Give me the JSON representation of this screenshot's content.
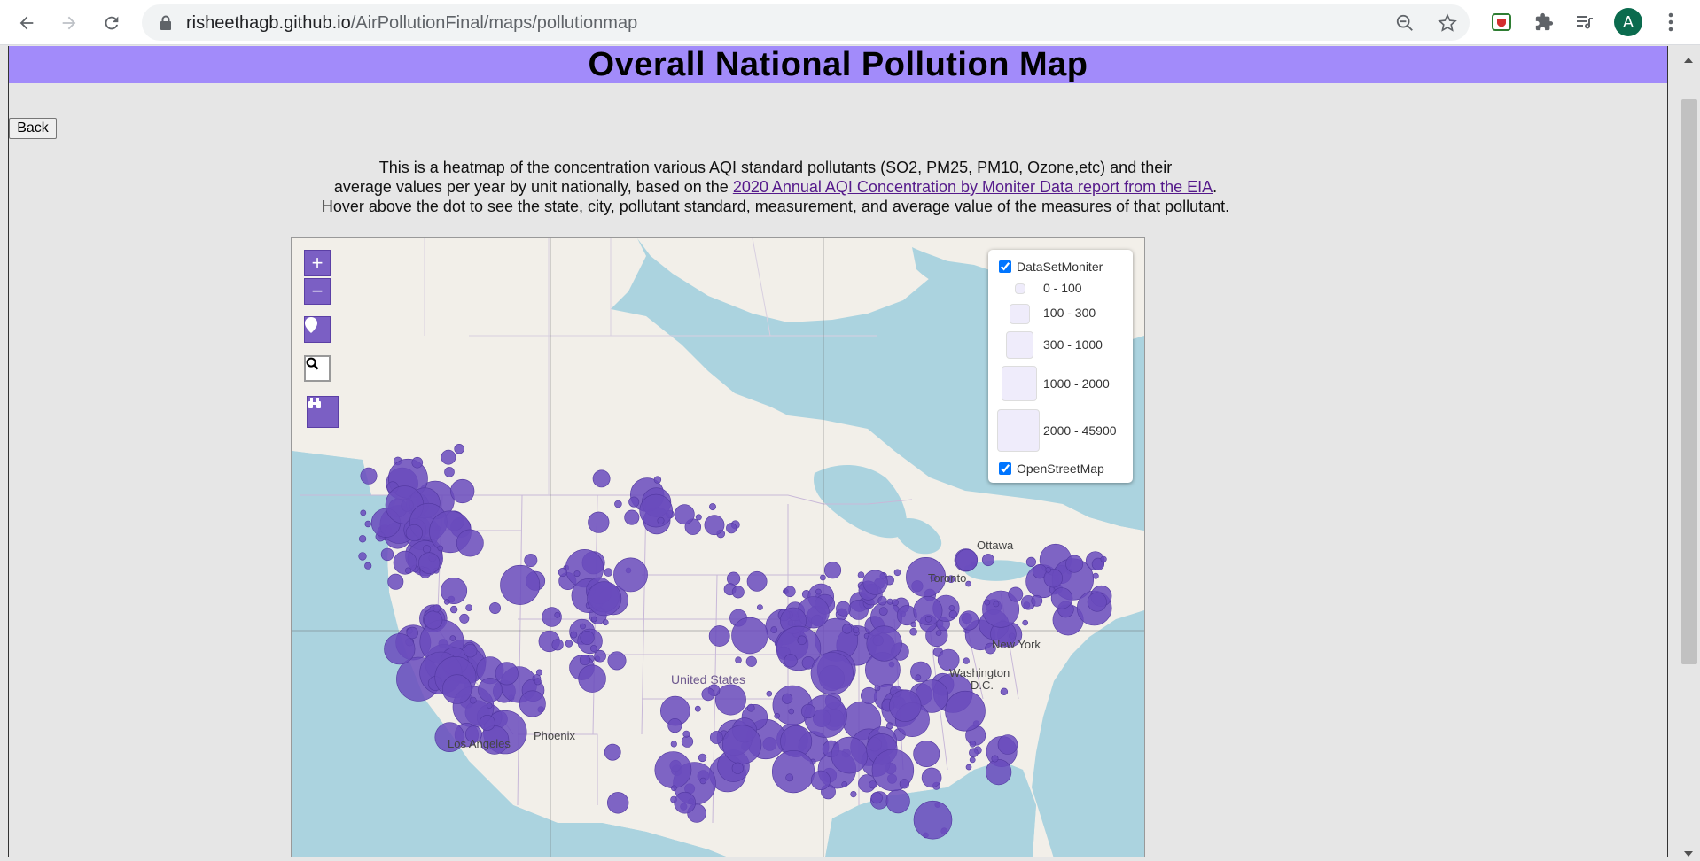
{
  "browser": {
    "url_host": "risheethagb.github.io",
    "url_path": "/AirPollutionFinal/maps/pollutionmap",
    "avatar_letter": "A"
  },
  "page": {
    "title": "Overall National Pollution Map",
    "back_label": "Back",
    "desc_line1": "This is a heatmap of the concentration various AQI standard pollutants (SO2, PM25, PM10, Ozone,etc) and their",
    "desc_line2_pre": "average values per year by unit nationally, based on the ",
    "desc_link": "2020 Annual AQI Concentration by Moniter Data report from the EIA",
    "desc_line2_post": ".",
    "desc_line3": "Hover above the dot to see the state, city, pollutant standard, measurement, and average value of the measures of that pollutant."
  },
  "map": {
    "controls": {
      "zoom_in": "+",
      "zoom_out": "−"
    },
    "labels": {
      "country": "United States",
      "ottawa": "Ottawa",
      "toronto": "Toronto",
      "new_york": "New York",
      "washington": "Washington",
      "dc": "D.C.",
      "phoenix": "Phoenix",
      "los_angeles": "Los Angeles"
    },
    "legend": {
      "layer1": "DataSetMoniter",
      "bins": [
        "0 - 100",
        "100 - 300",
        "300 - 1000",
        "1000 - 2000",
        "2000 - 45900"
      ],
      "layer2": "OpenStreetMap"
    },
    "colors": {
      "marker": "#6a4bbd",
      "water": "#abd3df",
      "land": "#f2efe9",
      "legend_swatch": "#efecfb"
    }
  }
}
